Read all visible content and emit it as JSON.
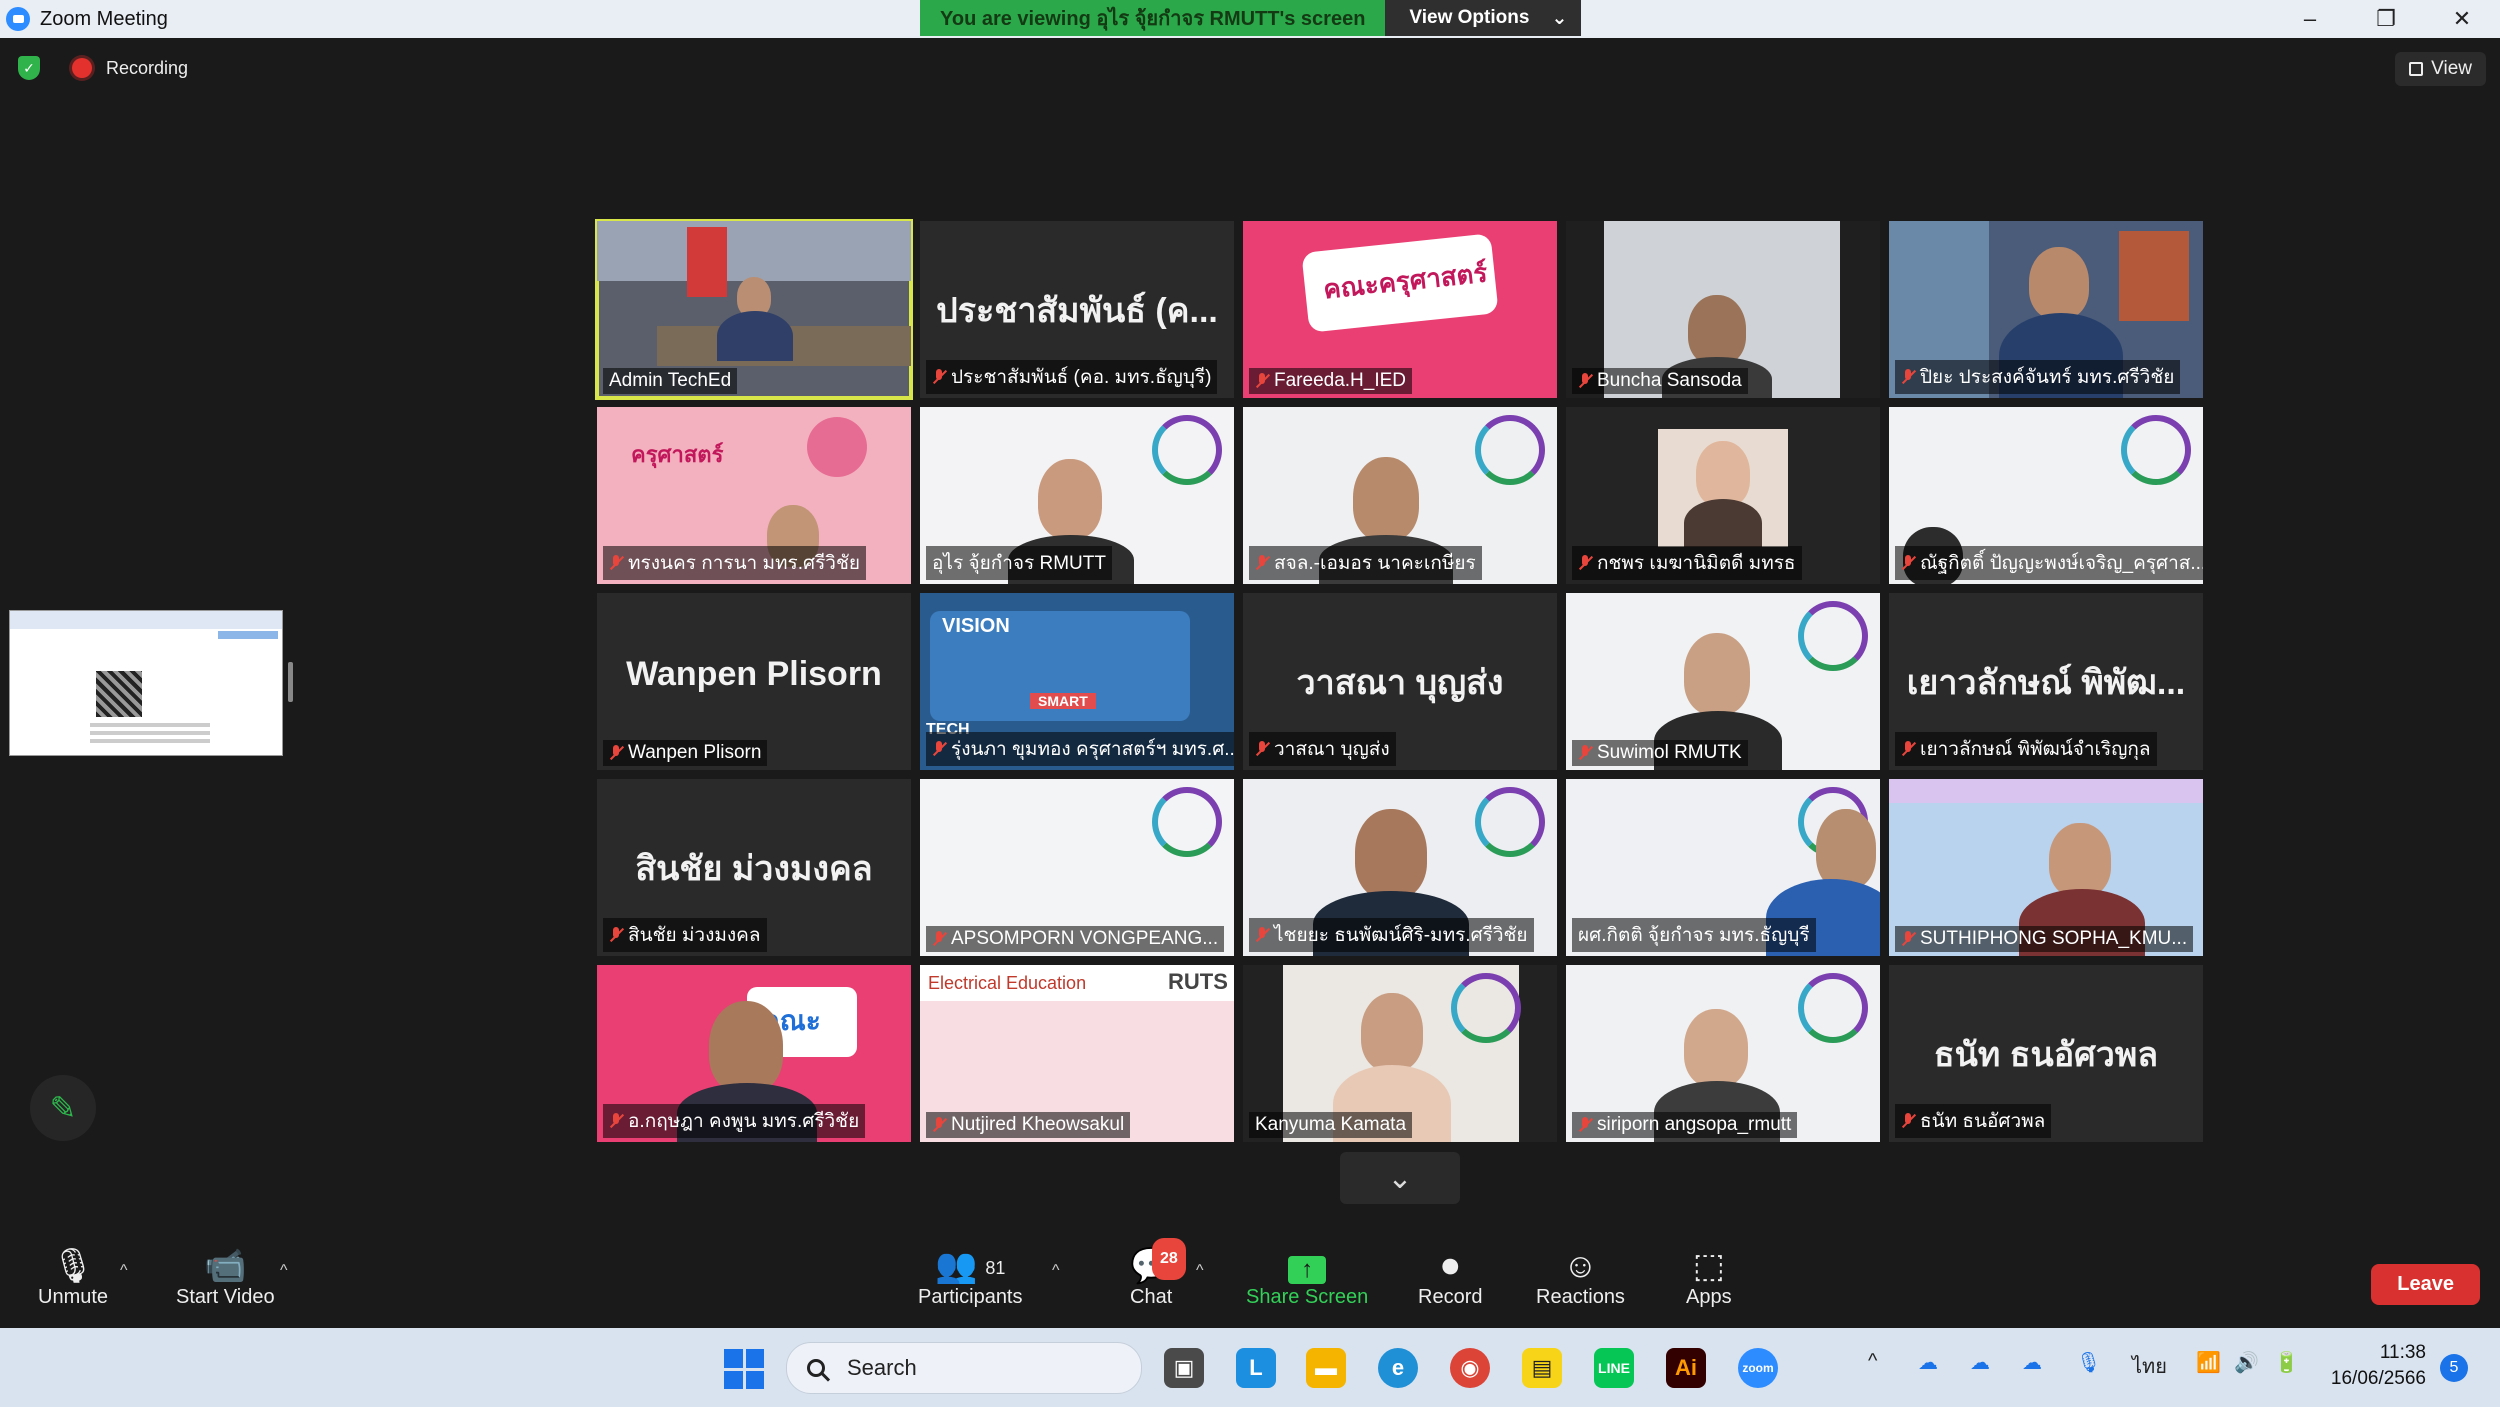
{
  "window": {
    "title": "Zoom Meeting"
  },
  "share_banner": {
    "message": "You are viewing อุไร จุ้ยกำจร RMUTT's screen",
    "options_label": "View Options"
  },
  "status": {
    "recording_label": "Recording"
  },
  "view_button": {
    "label": "View"
  },
  "tiles": [
    {
      "label": "Admin TechEd",
      "big_name": "",
      "muted": false,
      "active": true
    },
    {
      "label": "ประชาสัมพันธ์ (คอ. มทร.ธัญบุรี)",
      "big_name": "ประชาสัมพันธ์ (ค...",
      "muted": true
    },
    {
      "label": "Fareeda.H_IED",
      "big_name": "",
      "muted": true
    },
    {
      "label": "Buncha Sansoda",
      "big_name": "",
      "muted": true
    },
    {
      "label": "ปิยะ ประสงค์จันทร์ มทร.ศรีวิชัย",
      "big_name": "",
      "muted": true
    },
    {
      "label": "ทรงนคร การนา มทร.ศรีวิชัย",
      "big_name": "",
      "muted": true
    },
    {
      "label": "อุไร จุ้ยกำจร RMUTT",
      "big_name": "",
      "muted": false
    },
    {
      "label": "สจล.-เอมอร นาคะเกษียร",
      "big_name": "",
      "muted": true
    },
    {
      "label": "กชพร เมฆานิมิตดี มทรธ",
      "big_name": "",
      "muted": true
    },
    {
      "label": "ณัฐกิตติ์ ปัญญะพงษ์เจริญ_ครุศาส...",
      "big_name": "",
      "muted": true
    },
    {
      "label": "Wanpen Plisorn",
      "big_name": "Wanpen Plisorn",
      "muted": true
    },
    {
      "label": "รุ่งนภา ขุมทอง ครุศาสตร์ฯ มทร.ศ...",
      "big_name": "",
      "muted": true
    },
    {
      "label": "วาสณา บุญส่ง",
      "big_name": "วาสณา บุญส่ง",
      "muted": true
    },
    {
      "label": "Suwimol RMUTK",
      "big_name": "",
      "muted": true
    },
    {
      "label": "เยาวลักษณ์ พิพัฒน์จำเริญกุล",
      "big_name": "เยาวลักษณ์ พิพัฒ...",
      "muted": true
    },
    {
      "label": "สินชัย ม่วงมงคล",
      "big_name": "สินชัย ม่วงมงคล",
      "muted": true
    },
    {
      "label": "APSOMPORN VONGPEANG...",
      "big_name": "",
      "muted": true
    },
    {
      "label": "ไชยยะ ธนพัฒน์ศิริ-มทร.ศรีวิชัย",
      "big_name": "",
      "muted": true
    },
    {
      "label": "ผศ.กิตติ จุ้ยกำจร มทร.ธัญบุรี",
      "big_name": "",
      "muted": false
    },
    {
      "label": "SUTHIPHONG SOPHA_KMU...",
      "big_name": "",
      "muted": true
    },
    {
      "label": "อ.กฤษฎา คงพูน มทร.ศรีวิชัย",
      "big_name": "",
      "muted": true
    },
    {
      "label": "Nutjired Kheowsakul",
      "big_name": "",
      "muted": true
    },
    {
      "label": "Kanyuma Kamata",
      "big_name": "",
      "muted": false
    },
    {
      "label": "siriporn angsopa_rmutt",
      "big_name": "",
      "muted": true
    },
    {
      "label": "ธนัท ธนอัศวพล",
      "big_name": "ธนัท ธนอัศวพล",
      "muted": true
    }
  ],
  "tile_texts": {
    "vision": "VISION",
    "tech": "TECH",
    "elec": "Electrical Education",
    "ruts": "RUTS",
    "smart": "SMART",
    "kru": "คณะครุศาสตร์",
    "kru2": "ครุศาสตร์",
    "kru3": "คณะ"
  },
  "toolbar": {
    "unmute": "Unmute",
    "start_video": "Start Video",
    "participants": "Participants",
    "participants_count": "81",
    "chat": "Chat",
    "chat_badge": "28",
    "share_screen": "Share Screen",
    "record": "Record",
    "reactions": "Reactions",
    "apps": "Apps",
    "leave": "Leave"
  },
  "taskbar": {
    "search": "Search",
    "lang": "ไทย",
    "time": "11:38",
    "date": "16/06/2566",
    "notifications": "5"
  },
  "colors": {
    "accent_green": "#2aa84a",
    "leave_red": "#d9312f",
    "active_border": "#d8e64a",
    "muted_red": "#e8453c"
  }
}
